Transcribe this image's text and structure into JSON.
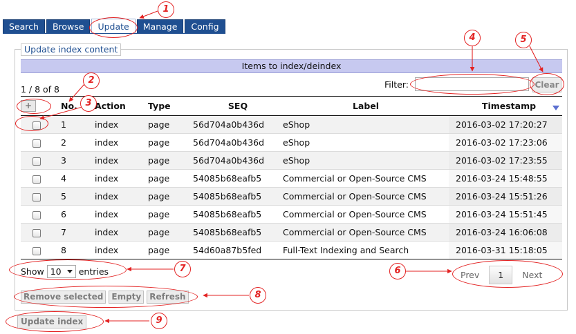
{
  "tabs": [
    {
      "label": "Search",
      "active": false
    },
    {
      "label": "Browse",
      "active": false
    },
    {
      "label": "Update",
      "active": true
    },
    {
      "label": "Manage",
      "active": false
    },
    {
      "label": "Config",
      "active": false
    }
  ],
  "panel": {
    "legend": "Update index content",
    "title": "Items to index/deindex",
    "info": "1 / 8 of 8",
    "filter_label": "Filter:",
    "filter_value": "",
    "clear_label": "Clear",
    "add_label": "+"
  },
  "table": {
    "columns": [
      "No.",
      "Action",
      "Type",
      "SEQ",
      "Label",
      "Timestamp"
    ],
    "rows": [
      {
        "no": "1",
        "action": "index",
        "type": "page",
        "seq": "56d704a0b436d",
        "label": "eShop",
        "timestamp": "2016-03-02 17:20:27"
      },
      {
        "no": "2",
        "action": "index",
        "type": "page",
        "seq": "56d704a0b436d",
        "label": "eShop",
        "timestamp": "2016-03-02 17:23:06"
      },
      {
        "no": "3",
        "action": "index",
        "type": "page",
        "seq": "56d704a0b436d",
        "label": "eShop",
        "timestamp": "2016-03-02 17:23:55"
      },
      {
        "no": "4",
        "action": "index",
        "type": "page",
        "seq": "54085b68eafb5",
        "label": "Commercial or Open-Source CMS",
        "timestamp": "2016-03-24 15:48:55"
      },
      {
        "no": "5",
        "action": "index",
        "type": "page",
        "seq": "54085b68eafb5",
        "label": "Commercial or Open-Source CMS",
        "timestamp": "2016-03-24 15:51:26"
      },
      {
        "no": "6",
        "action": "index",
        "type": "page",
        "seq": "54085b68eafb5",
        "label": "Commercial or Open-Source CMS",
        "timestamp": "2016-03-24 15:51:45"
      },
      {
        "no": "7",
        "action": "index",
        "type": "page",
        "seq": "54085b68eafb5",
        "label": "Commercial or Open-Source CMS",
        "timestamp": "2016-03-24 16:06:08"
      },
      {
        "no": "8",
        "action": "index",
        "type": "page",
        "seq": "54d60a87b5fed",
        "label": "Full-Text Indexing and Search",
        "timestamp": "2016-03-31 15:18:05"
      }
    ]
  },
  "length": {
    "show_label": "Show",
    "value": "10",
    "entries_label": "entries"
  },
  "pager": {
    "prev": "Prev",
    "current": "1",
    "next": "Next"
  },
  "buttons": {
    "remove_selected": "Remove selected",
    "empty": "Empty",
    "refresh": "Refresh",
    "update_index": "Update index"
  },
  "annotations": [
    "1",
    "2",
    "3",
    "4",
    "5",
    "6",
    "7",
    "8",
    "9"
  ],
  "colors": {
    "tab": "#1f4f91",
    "title_bar": "#c7c9f0",
    "annotation": "#e32222",
    "sort_icon": "#5b6fd0"
  }
}
